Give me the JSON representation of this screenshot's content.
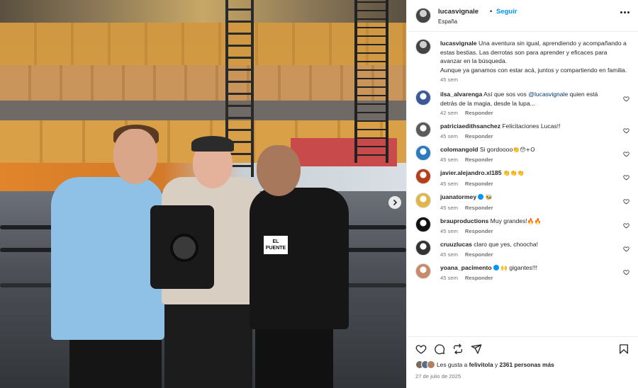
{
  "header": {
    "username": "lucasvignale",
    "separator": "•",
    "follow_label": "Seguir",
    "location": "España"
  },
  "photo": {
    "plate_text": "EL PUENTE"
  },
  "caption": {
    "username": "lucasvignale",
    "text": "Una aventura sin igual, aprendiendo y acompañando a estas bestias. Las derrotas son para aprender y eficaces para avanzar en la búsqueda.",
    "text2": "Aunque ya ganamos con estar acá, juntos y compartiendo en familia.",
    "time": "45 sem"
  },
  "comments": [
    {
      "username": "ilsa_alvarenga",
      "pre": "Así que sos vos ",
      "mention": "@lucasvignale",
      "post": " quien está detrás de la magia, desde la lupa...",
      "time": "42 sem",
      "reply_label": "Responder",
      "avatar_color": "#3b5998"
    },
    {
      "username": "patriciaedithsanchez",
      "pre": "Felicitaciones Lucas!!",
      "mention": "",
      "post": "",
      "time": "45 sem",
      "reply_label": "Responder",
      "avatar_color": "#5a5a5a"
    },
    {
      "username": "colomangold",
      "pre": "Si gordoooo",
      "mention": "",
      "post": "",
      "emoji": "👏😯+O",
      "time": "45 sem",
      "reply_label": "Responder",
      "avatar_color": "#2b7bc0"
    },
    {
      "username": "javier.alejandro.xl185",
      "pre": "",
      "mention": "",
      "post": "",
      "emoji": "👏👏👏",
      "time": "45 sem",
      "reply_label": "Responder",
      "avatar_color": "#b3401a"
    },
    {
      "username": "juanatormey",
      "pre": "",
      "mention": "",
      "post": "",
      "emoji": "🐝",
      "verified": true,
      "time": "45 sem",
      "reply_label": "Responder",
      "avatar_color": "#e0b64a"
    },
    {
      "username": "brauproductions",
      "pre": "Muy grandes!",
      "mention": "",
      "post": "",
      "emoji": "🔥🔥",
      "time": "45 sem",
      "reply_label": "Responder",
      "avatar_color": "#111111"
    },
    {
      "username": "cruuzlucas",
      "pre": "claro que yes, choocha!",
      "mention": "",
      "post": "",
      "time": "45 sem",
      "reply_label": "Responder",
      "avatar_color": "#333333"
    },
    {
      "username": "yoana_pacimento",
      "pre": "",
      "mention": "",
      "post": "gigantes!!!",
      "emoji": "🙌",
      "verified": true,
      "time": "45 sem",
      "reply_label": "Responder",
      "avatar_color": "#c98a6a"
    }
  ],
  "likes": {
    "text_pre": "Les gusta a ",
    "user": "felivitola",
    "text_mid": " y ",
    "count": "2361 personas más"
  },
  "date": "27 de julio de 2025",
  "colors": {
    "accent": "#0095f6",
    "text": "#262626",
    "muted": "#737373"
  }
}
